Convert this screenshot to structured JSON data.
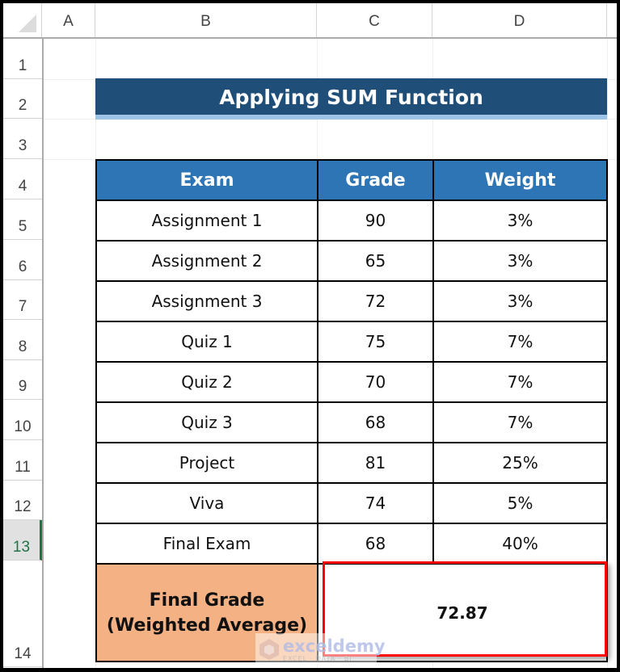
{
  "spreadsheet": {
    "columns": [
      "A",
      "B",
      "C",
      "D"
    ],
    "rows": [
      "1",
      "2",
      "3",
      "4",
      "5",
      "6",
      "7",
      "8",
      "9",
      "10",
      "11",
      "12",
      "13",
      "14"
    ],
    "selected_row": "13"
  },
  "title": "Applying SUM Function",
  "table": {
    "headers": [
      "Exam",
      "Grade",
      "Weight"
    ],
    "rows": [
      {
        "exam": "Assignment 1",
        "grade": "90",
        "weight": "3%"
      },
      {
        "exam": "Assignment 2",
        "grade": "65",
        "weight": "3%"
      },
      {
        "exam": "Assignment 3",
        "grade": "72",
        "weight": "3%"
      },
      {
        "exam": "Quiz 1",
        "grade": "75",
        "weight": "7%"
      },
      {
        "exam": "Quiz 2",
        "grade": "70",
        "weight": "7%"
      },
      {
        "exam": "Quiz 3",
        "grade": "68",
        "weight": "7%"
      },
      {
        "exam": "Project",
        "grade": "81",
        "weight": "25%"
      },
      {
        "exam": "Viva",
        "grade": "74",
        "weight": "5%"
      },
      {
        "exam": "Final Exam",
        "grade": "68",
        "weight": "40%"
      }
    ],
    "final": {
      "label_line1": "Final Grade",
      "label_line2": "(Weighted Average)",
      "value": "72.87"
    }
  },
  "watermark": {
    "brand": "exceldemy",
    "tagline": "EXCEL · DATA · BI"
  },
  "colors": {
    "title_bg": "#1f4e79",
    "header_bg": "#2e75b6",
    "final_label_bg": "#f4b183",
    "highlight_border": "#ff0000",
    "selected_row_accent": "#217346"
  }
}
